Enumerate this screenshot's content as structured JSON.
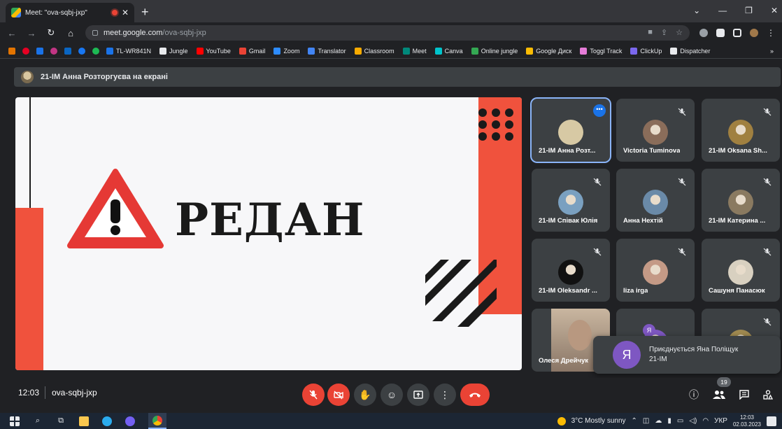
{
  "browser": {
    "tab_title": "Meet: \"ova-sqbj-jxp\"",
    "url_host": "meet.google.com",
    "url_path": "/ova-sqbj-jxp",
    "bookmarks": [
      {
        "label": "TL-WR841N",
        "color": "#1a73e8"
      },
      {
        "label": "Jungle",
        "color": "#e8eaed"
      },
      {
        "label": "YouTube",
        "color": "#ff0000"
      },
      {
        "label": "Gmail",
        "color": "#ea4335"
      },
      {
        "label": "Zoom",
        "color": "#2d8cff"
      },
      {
        "label": "Translator",
        "color": "#4285f4"
      },
      {
        "label": "Classroom",
        "color": "#f9ab00"
      },
      {
        "label": "Meet",
        "color": "#00897b"
      },
      {
        "label": "Canva",
        "color": "#00c4cc"
      },
      {
        "label": "Online jungle",
        "color": "#34a853"
      },
      {
        "label": "Google Диск",
        "color": "#fbbc04"
      },
      {
        "label": "Toggl Track",
        "color": "#e57cd8"
      },
      {
        "label": "ClickUp",
        "color": "#7b68ee"
      },
      {
        "label": "Dispatcher",
        "color": "#e8eaed"
      }
    ],
    "overflow": "»"
  },
  "meet": {
    "presenter_banner": "21-ІМ Анна Розторгуєва на екрані",
    "slide_word": "РЕДАН",
    "participants": [
      {
        "name": "21-ІМ Анна Розт...",
        "avatar": "#d7c9a4",
        "active": true
      },
      {
        "name": "Victoria Tuminova",
        "avatar": "#8a6d5a"
      },
      {
        "name": "21-ІМ Oksana Sh...",
        "avatar": "#a08040"
      },
      {
        "name": "21-ІМ Співак Юлія",
        "avatar": "#7aa0c0"
      },
      {
        "name": "Анна Нехтій",
        "avatar": "#6a8aa8"
      },
      {
        "name": "21-ІМ Катерина ...",
        "avatar": "#8a7a60"
      },
      {
        "name": "21-ІМ Oleksandr ...",
        "avatar": "#111111"
      },
      {
        "name": "liza irga",
        "avatar": "#c49a86"
      },
      {
        "name": "Сашуня Панасюк",
        "avatar": "#d8d0c0"
      },
      {
        "name": "Олеся Дрейчук",
        "avatar": "#9a8878"
      },
      {
        "name": "",
        "avatar": "#7e57c2"
      },
      {
        "name": "",
        "avatar": "#a08a50"
      }
    ],
    "toast_letter": "Я",
    "toast_line1": "Приєднується Яна Поліщук",
    "toast_line2": "21-ІМ",
    "small_avatar_letter": "Я",
    "time": "12:03",
    "meeting_code": "ova-sqbj-jxp",
    "people_count": "19"
  },
  "taskbar": {
    "weather": "3°C  Mostly sunny",
    "lang": "УКР",
    "time": "12:03",
    "date": "02.03.2023"
  }
}
